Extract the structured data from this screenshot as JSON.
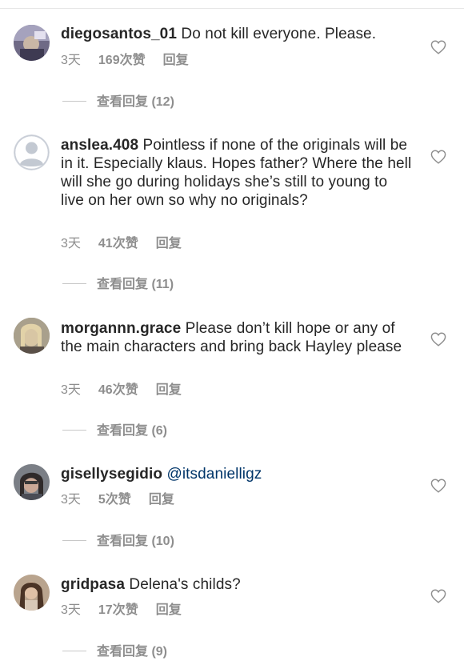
{
  "comments": [
    {
      "username": "diegosantos_01",
      "text": "Do not kill everyone. Please.",
      "mention": "",
      "time": "3天",
      "likes": "169次赞",
      "reply": "回复",
      "view_replies": "查看回复 (12)"
    },
    {
      "username": "anslea.408",
      "text": "Pointless if none of the originals will be in it. Especially klaus. Hopes father? Where the hell will she go during holidays she’s still to young to live on her own so why no originals?",
      "mention": "",
      "time": "3天",
      "likes": "41次赞",
      "reply": "回复",
      "view_replies": "查看回复 (11)"
    },
    {
      "username": "morgannn.grace",
      "text": "Please don’t kill hope or any of the main characters and bring back Hayley please",
      "mention": "",
      "time": "3天",
      "likes": "46次赞",
      "reply": "回复",
      "view_replies": "查看回复 (6)"
    },
    {
      "username": "gisellysegidio",
      "text": "",
      "mention": "@itsdanielligz",
      "time": "3天",
      "likes": "5次赞",
      "reply": "回复",
      "view_replies": "查看回复 (10)"
    },
    {
      "username": "gridpasa",
      "text": "Delena's childs?",
      "mention": "",
      "time": "3天",
      "likes": "17次赞",
      "reply": "回复",
      "view_replies": "查看回复 (9)"
    }
  ],
  "icons": {
    "like": "heart-outline-icon",
    "default_avatar": "default-avatar-icon"
  },
  "colors": {
    "text": "#262626",
    "secondary": "#8e8e8e",
    "mention": "#003569",
    "divider": "#c7c7c7"
  }
}
